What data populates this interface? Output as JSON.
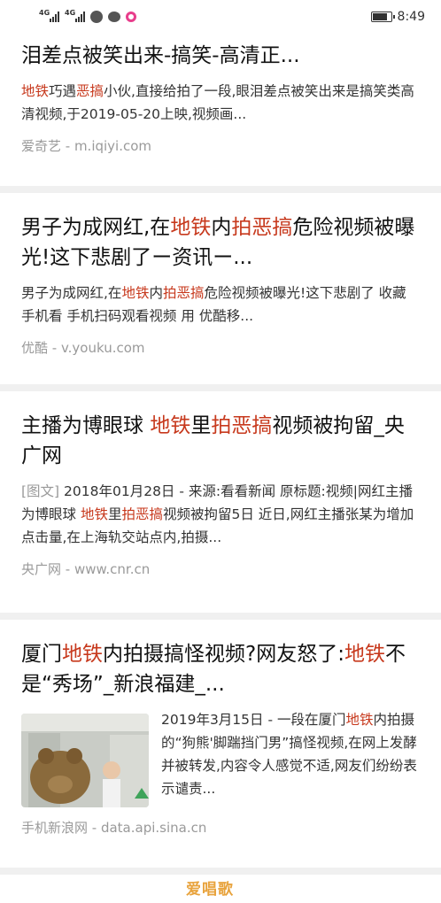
{
  "status": {
    "time": "8:49",
    "net1": "4G",
    "net2": "4G"
  },
  "results": [
    {
      "title": [
        {
          "t": "泪差点被笑出来-搞笑-高清正..."
        }
      ],
      "snippet": [
        {
          "t": "地铁",
          "hl": true
        },
        {
          "t": "巧遇"
        },
        {
          "t": "恶搞",
          "hl": true
        },
        {
          "t": "小伙,直接给拍了一段,眼泪差点被笑出来是搞笑类高清视频,于2019-05-20上映,视频画..."
        }
      ],
      "source": "爱奇艺 - m.iqiyi.com"
    },
    {
      "title": [
        {
          "t": "男子为成网红,在"
        },
        {
          "t": "地铁",
          "hl": true
        },
        {
          "t": "内"
        },
        {
          "t": "拍恶搞",
          "hl": true
        },
        {
          "t": "危险视频被曝光!这下悲剧了ー资讯ー..."
        }
      ],
      "snippet": [
        {
          "t": "男子为成网红,在"
        },
        {
          "t": "地铁",
          "hl": true
        },
        {
          "t": "内"
        },
        {
          "t": "拍恶搞",
          "hl": true
        },
        {
          "t": "危险视频被曝光!这下悲剧了 收藏 手机看 手机扫码观看视频 用 优酷移..."
        }
      ],
      "source": "优酷 - v.youku.com"
    },
    {
      "title": [
        {
          "t": "主播为博眼球 "
        },
        {
          "t": "地铁",
          "hl": true
        },
        {
          "t": "里"
        },
        {
          "t": "拍恶搞",
          "hl": true
        },
        {
          "t": "视频被拘留_央广网"
        }
      ],
      "tag": "[图文]",
      "snippet": [
        {
          "t": " 2018年01月28日 - 来源:看看新闻 原标题:视频|网红主播为博眼球 "
        },
        {
          "t": "地铁",
          "hl": true
        },
        {
          "t": "里"
        },
        {
          "t": "拍恶搞",
          "hl": true
        },
        {
          "t": "视频被拘留5日 近日,网红主播张某为增加点击量,在上海轨交站点内,拍摄..."
        }
      ],
      "source": "央广网 - www.cnr.cn"
    },
    {
      "title": [
        {
          "t": "厦门"
        },
        {
          "t": "地铁",
          "hl": true
        },
        {
          "t": "内拍摄搞怪视频?网友怒了:"
        },
        {
          "t": "地铁",
          "hl": true
        },
        {
          "t": "不是“秀场”_新浪福建_..."
        }
      ],
      "snippet": [
        {
          "t": "2019年3月15日 - 一段在厦门"
        },
        {
          "t": "地铁",
          "hl": true
        },
        {
          "t": "内拍摄的“狗熊'脚踹挡门男”搞怪视频,在网上发酵并被转发,内容令人感觉不适,网友们纷纷表示谴责..."
        }
      ],
      "source": "手机新浪网 - data.api.sina.cn"
    }
  ],
  "watermark": "爱唱歌",
  "colors": {
    "highlight": "#c7391d",
    "source": "#9a9a9a"
  }
}
